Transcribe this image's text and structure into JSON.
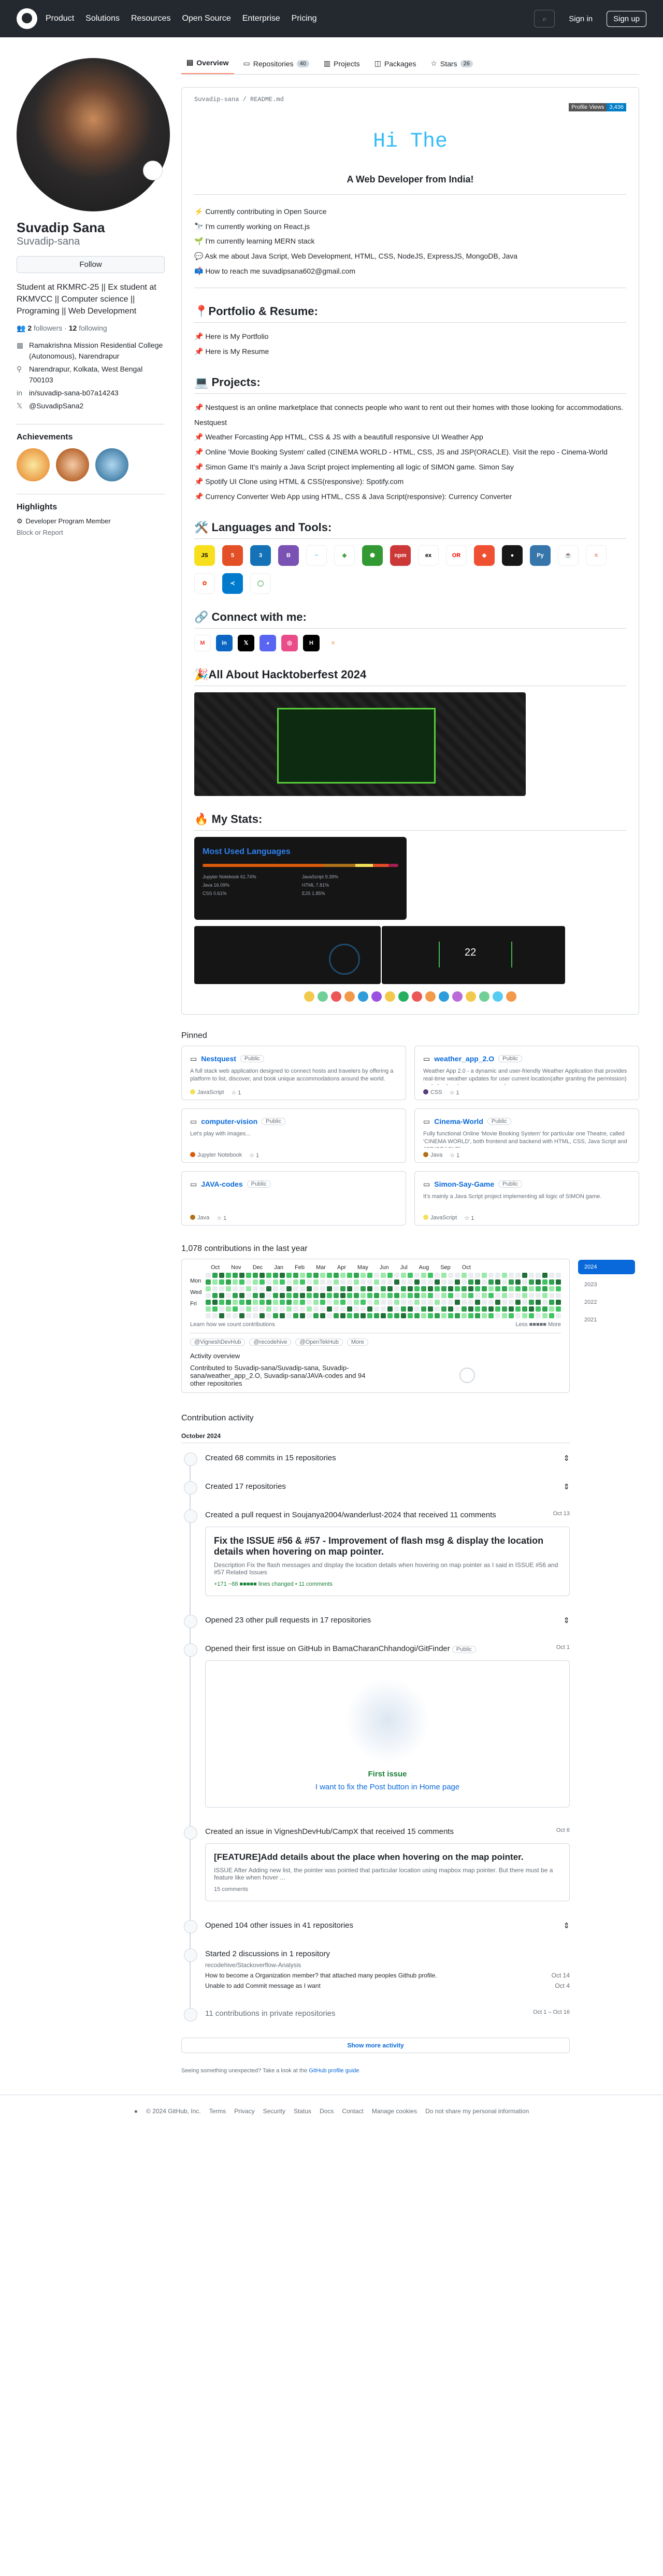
{
  "header": {
    "nav": [
      "Product",
      "Solutions",
      "Resources",
      "Open Source",
      "Enterprise",
      "Pricing"
    ],
    "sign_in": "Sign in",
    "sign_up": "Sign up"
  },
  "profile": {
    "name": "Suvadip Sana",
    "login": "Suvadip-sana",
    "follow": "Follow",
    "bio": "Student at RKMRC-25 || Ex student at RKMVCC || Computer science || Programing || Web Development",
    "followers": "2",
    "followers_label": "followers",
    "following": "12",
    "following_label": "following",
    "org": "Ramakrishna Mission Residential College (Autonomous), Narendrapur",
    "location": "Narendrapur, Kolkata, West Bengal 700103",
    "linkedin": "in/suvadip-sana-b07a14243",
    "twitter": "@SuvadipSana2",
    "achievements": "Achievements",
    "highlights": "Highlights",
    "highlight_item": "Developer Program Member",
    "block": "Block or Report"
  },
  "tabs": [
    {
      "label": "Overview"
    },
    {
      "label": "Repositories",
      "count": "40"
    },
    {
      "label": "Projects"
    },
    {
      "label": "Packages"
    },
    {
      "label": "Stars",
      "count": "26"
    }
  ],
  "readme": {
    "path": "Suvadip-sana / README.md",
    "pv_label": "Profile Views",
    "pv_value": "3,436",
    "hi": "Hi The",
    "tagline": "A Web Developer from India!",
    "bullets": [
      "⚡ Currently contributing in Open Source",
      "🔭 I'm currently working on React.js",
      "🌱 I'm currently learning MERN stack",
      "💬 Ask me about Java Script, Web Development, HTML, CSS, NodeJS, ExpressJS, MongoDB, Java",
      "📫 How to reach me suvadipsana602@gmail.com"
    ],
    "portfolio_h": "📍Portfolio & Resume:",
    "portfolio": [
      "📌 Here is My Portfolio",
      "📌 Here is My Resume"
    ],
    "projects_h": "💻 Projects:",
    "projects": [
      "📌 Nestquest is an online marketplace that connects people who want to rent out their homes with those looking for accommodations. Nestquest",
      "📌 Weather Forcasting App HTML, CSS & JS with a beautifull responsive UI Weather App",
      "📌 Online 'Movie Booking System' called (CINEMA WORLD - HTML, CSS, JS and JSP(ORACLE). Visit the repo - Cinema-World",
      "📌 Simon Game It's mainly a Java Script project implementing all logic of SIMON game. Simon Say",
      "📌 Spotify UI Clone using HTML & CSS(responsive): Spotify.com",
      "📌 Currency Converter Web App using HTML, CSS & Java Script(responsive): Currency Converter"
    ],
    "lang_h": "🛠️ Languages and Tools:",
    "connect_h": "🔗 Connect with me:",
    "hack_h": "🎉All About Hacktoberfest 2024",
    "stats_h": "🔥 My Stats:",
    "mul": "Most Used Languages",
    "langs": [
      "Jupyter Notebook 61.74%",
      "JavaScript 9.39%",
      "Java 16.09%",
      "HTML 7.81%",
      "CSS 0.61%",
      "EJS 1.85%"
    ],
    "streak": "22"
  },
  "pinned_h": "Pinned",
  "pins": [
    {
      "name": "Nestquest",
      "pub": "Public",
      "desc": "A full stack web application designed to connect hosts and travelers by offering a platform to list, discover, and book unique accommodations around the world.",
      "lang": "JavaScript",
      "color": "#f1e05a",
      "stars": "1"
    },
    {
      "name": "weather_app_2.O",
      "pub": "Public",
      "desc": "Weather App 2.0 - a dynamic and user-friendly Weather Application that provides real-time weather updates for user current location(after granting the permission) and also by city name you search...",
      "lang": "CSS",
      "color": "#563d7c",
      "stars": "1"
    },
    {
      "name": "computer-vision",
      "pub": "Public",
      "desc": "Let's play with images...",
      "lang": "Jupyter Notebook",
      "color": "#DA5B0B",
      "stars": "1"
    },
    {
      "name": "Cinema-World",
      "pub": "Public",
      "desc": "Fully functional Online 'Movie Booking System' for particular one Theatre, called 'CINEMA WORLD', both frontend and backend with HTML, CSS, Java Script and JSP(ORACLE).",
      "lang": "Java",
      "color": "#b07219",
      "stars": "1"
    },
    {
      "name": "JAVA-codes",
      "pub": "Public",
      "desc": "",
      "lang": "Java",
      "color": "#b07219",
      "stars": "1"
    },
    {
      "name": "Simon-Say-Game",
      "pub": "Public",
      "desc": "It's mainly a Java Script project implementing all logic of SIMON game.",
      "lang": "JavaScript",
      "color": "#f1e05a",
      "stars": "1"
    }
  ],
  "contrib": {
    "title": "1,078 contributions in the last year",
    "months": [
      "Oct",
      "Nov",
      "Dec",
      "Jan",
      "Feb",
      "Mar",
      "Apr",
      "May",
      "Jun",
      "Jul",
      "Aug",
      "Sep",
      "Oct"
    ],
    "days": [
      "Mon",
      "Wed",
      "Fri"
    ],
    "learn": "Learn how we count contributions",
    "less": "Less",
    "more": "More",
    "years": [
      "2024",
      "2023",
      "2022",
      "2021"
    ],
    "orgs": [
      "@VigneshDevHub",
      "@recodehive",
      "@OpenTekHub",
      "More"
    ],
    "overview": "Activity overview",
    "contributed": "Contributed to Suvadip-sana/Suvadip-sana, Suvadip-sana/weather_app_2.O, Suvadip-sana/JAVA-codes and 94 other repositories"
  },
  "activity": {
    "heading": "Contribution activity",
    "month": "October 2024",
    "e1": "Created 68 commits in 15 repositories",
    "e2": "Created 17 repositories",
    "e3": "Created a pull request in Soujanya2004/wanderlust-2024 that received 11 comments",
    "e3date": "Oct 13",
    "pr_title": "Fix the ISSUE #56 & #57 - Improvement of flash msg & display the location details when hovering on map pointer.",
    "pr_desc": "Description Fix the flash messages and display the location details when hovering on map pointer as I said in ISSUE #56 and #57 Related Issues",
    "pr_stats": "+171 −88 ■■■■■ lines changed • 11 comments",
    "e4": "Opened 23 other pull requests in 17 repositories",
    "e5": "Opened their first issue on GitHub in BamaCharanChhandogi/GitFinder",
    "e5pub": "Public",
    "e5date": "Oct 1",
    "fi": "First issue",
    "fi_link": "I want to fix the Post button in Home page",
    "e6": "Created an issue in VigneshDevHub/CampX that received 15 comments",
    "e6date": "Oct 6",
    "is_title": "[FEATURE]Add details about the place when hovering on the map pointer.",
    "is_desc": "ISSUE After Adding new list, the pointer was pointed that particular location using mapbox map pointer. But there must be a feature like when hover ...",
    "is_cm": "15 comments",
    "e7": "Opened 104 other issues in 41 repositories",
    "e8": "Started 2 discussions in 1 repository",
    "e8repo": "recodehive/Stackoverflow-Analysis",
    "d1": "How to become a Organization member? that attached many peoples Github profile.",
    "d1date": "Oct 14",
    "d2": "Unable to add Commit message as I want",
    "d2date": "Oct 4",
    "e9": "11 contributions in private repositories",
    "e9date": "Oct 1 – Oct 16",
    "more": "Show more activity",
    "note": "Seeing something unexpected? Take a look at the",
    "note_link": "GitHub profile guide"
  },
  "footer": [
    "© 2024 GitHub, Inc.",
    "Terms",
    "Privacy",
    "Security",
    "Status",
    "Docs",
    "Contact",
    "Manage cookies",
    "Do not share my personal information"
  ]
}
